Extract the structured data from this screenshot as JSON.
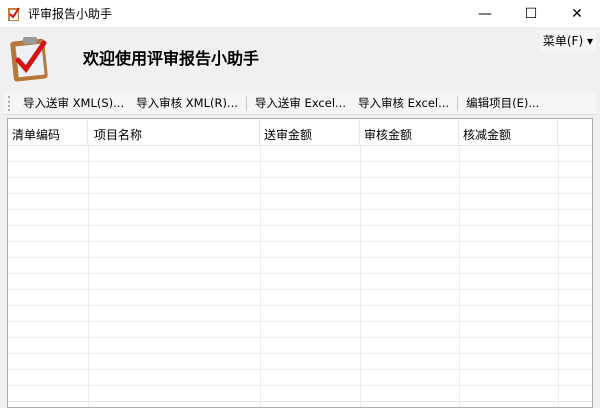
{
  "window": {
    "title": "评审报告小助手",
    "minimize": "—",
    "maximize": "☐",
    "close": "✕"
  },
  "menu": {
    "label": "菜单(F)",
    "arrow": "▾"
  },
  "header": {
    "welcome": "欢迎使用评审报告小助手"
  },
  "toolbar": {
    "items": [
      "导入送审 XML(S)...",
      "导入审核 XML(R)...",
      "导入送审 Excel...",
      "导入审核 Excel...",
      "编辑项目(E)..."
    ]
  },
  "table": {
    "columns": [
      "清单编码",
      "项目名称",
      "送审金额",
      "审核金额",
      "核减金额"
    ]
  }
}
